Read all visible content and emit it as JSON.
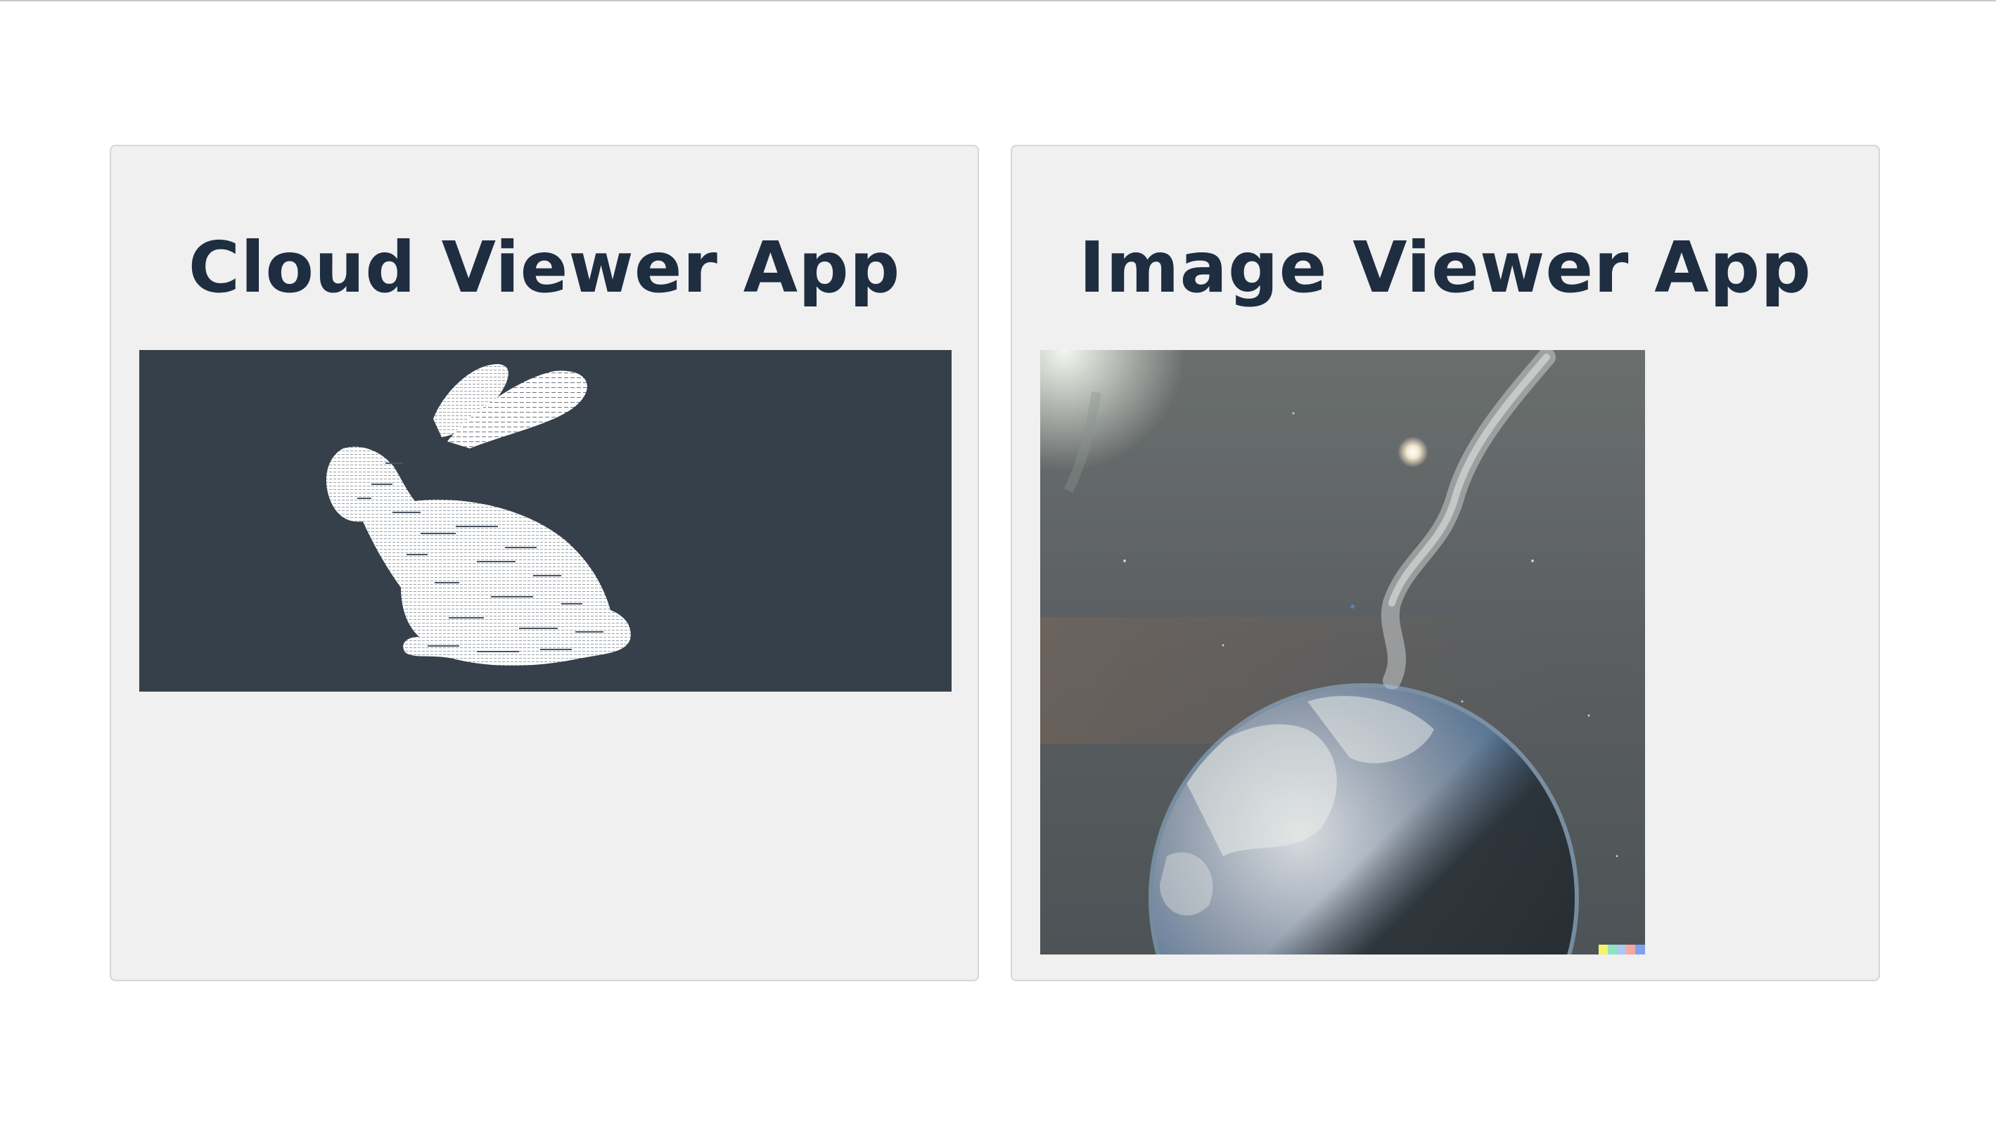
{
  "apps": [
    {
      "title": "Cloud Viewer App",
      "content": "point-cloud-bunny",
      "background_color": "#36404a"
    },
    {
      "title": "Image Viewer App",
      "content": "planet-in-space-image"
    }
  ],
  "colors": {
    "title": "#1e2d40",
    "card_background": "#f0f0f0",
    "card_border": "#d6d6d6"
  }
}
